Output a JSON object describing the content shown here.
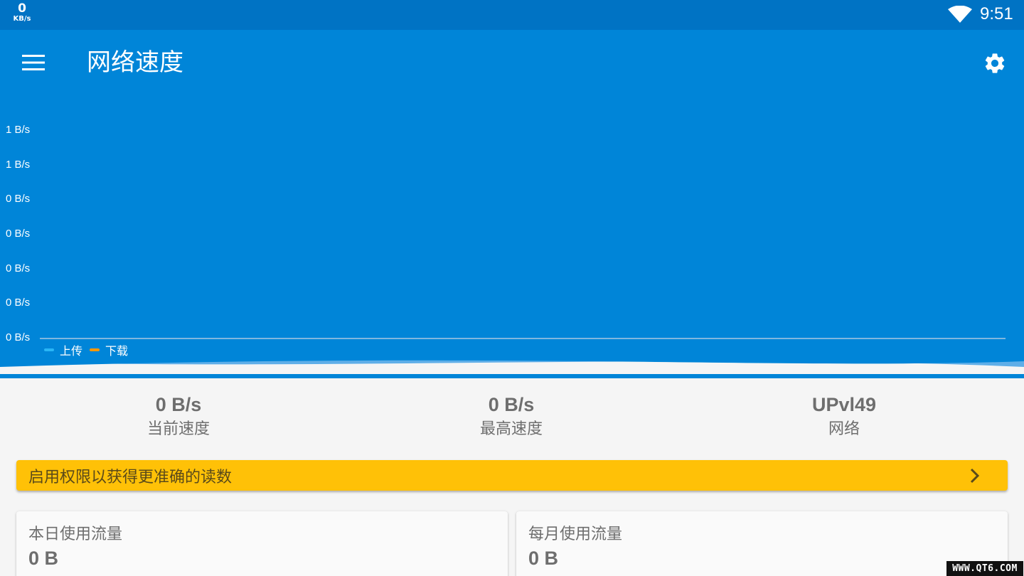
{
  "status_bar": {
    "net_speed_value": "0",
    "net_speed_unit": "KB/s",
    "time": "9:51"
  },
  "app_bar": {
    "title": "网络速度",
    "menu_icon": "hamburger-menu-icon",
    "settings_icon": "gear-icon"
  },
  "chart_data": {
    "type": "line",
    "y_tick_labels": [
      "1 B/s",
      "1 B/s",
      "0 B/s",
      "0 B/s",
      "0 B/s",
      "0 B/s",
      "0 B/s"
    ],
    "series": [
      {
        "name": "上传",
        "color": "#29b6f6",
        "values": []
      },
      {
        "name": "下载",
        "color": "#ff9800",
        "values": []
      }
    ],
    "legend_placement": "bottom-left",
    "grid": false
  },
  "stats": {
    "current_speed": {
      "value": "0 B/s",
      "label": "当前速度"
    },
    "max_speed": {
      "value": "0 B/s",
      "label": "最高速度"
    },
    "network": {
      "value": "UPvl49",
      "label": "网络"
    }
  },
  "permission_banner": {
    "text": "启用权限以获得更准确的读数",
    "color": "#ffc107"
  },
  "usage_cards": {
    "daily": {
      "label": "本日使用流量",
      "value": "0 B"
    },
    "monthly": {
      "label": "每月使用流量",
      "value": "0 B"
    }
  },
  "watermark": "WWW.QT6.COM",
  "colors": {
    "status_bar": "#0073c4",
    "app_bar": "#0085d8",
    "background": "#f5f5f5"
  }
}
